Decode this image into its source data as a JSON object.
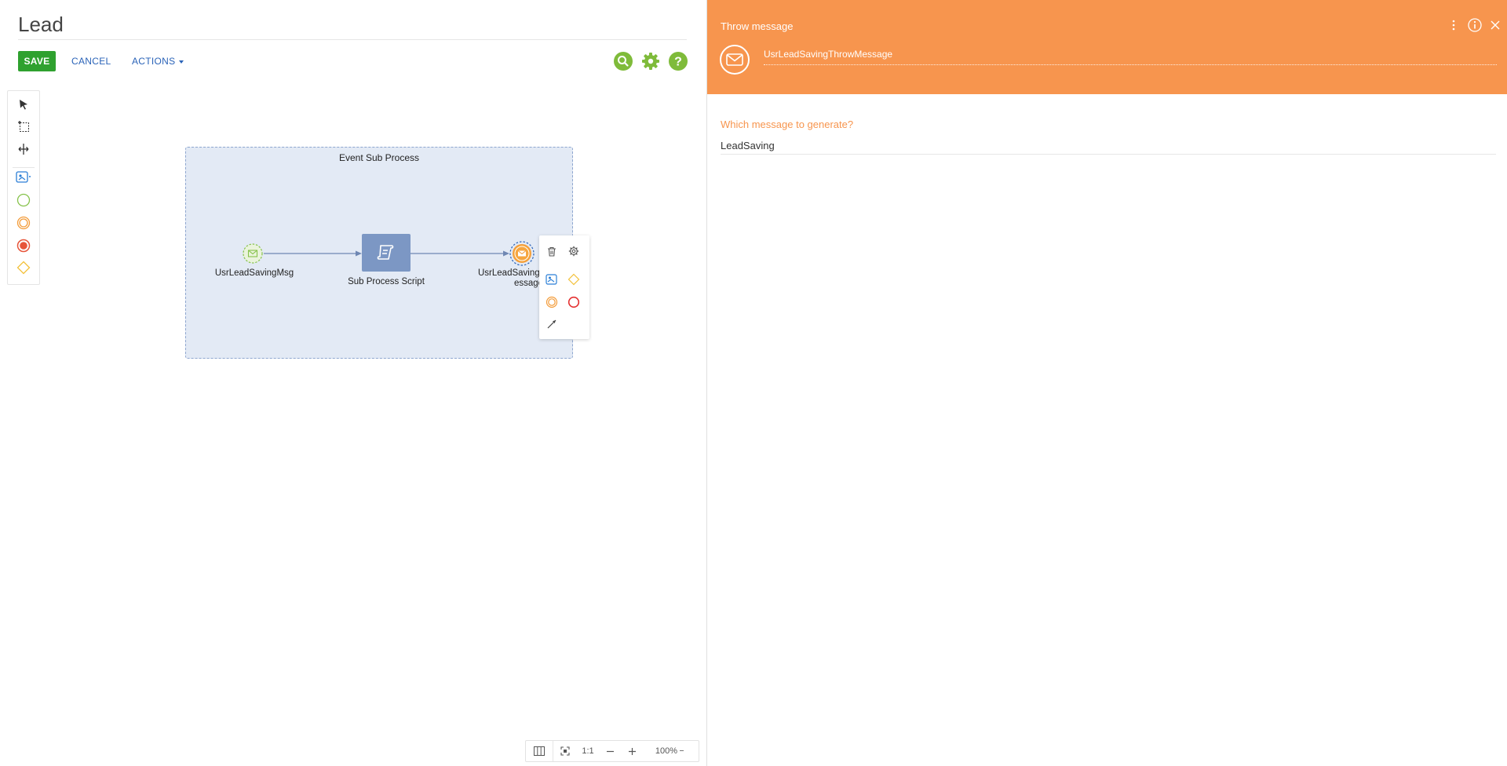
{
  "designer": {
    "title": "Lead",
    "toolbar": {
      "save_label": "SAVE",
      "cancel_label": "CANCEL",
      "actions_label": "ACTIONS"
    },
    "top_icons": [
      "search-icon",
      "gear-icon",
      "help-icon"
    ],
    "palette": [
      "pointer-tool",
      "lasso-tool",
      "space-tool",
      "script-task",
      "start-event",
      "intermediate-event",
      "end-event",
      "gateway"
    ],
    "subprocess": {
      "title": "Event Sub Process",
      "nodes": [
        {
          "label": "UsrLeadSavingMsg"
        },
        {
          "label": "Sub Process Script"
        },
        {
          "label_line1": "UsrLeadSavingT",
          "label_line2": "essage"
        }
      ]
    },
    "context_menu": [
      "trash-icon",
      "gear-icon",
      "script-task-icon",
      "gateway-icon",
      "intermediate-event-icon",
      "end-event-icon",
      "connector-icon"
    ],
    "zoom": {
      "fit_label": "1:1",
      "level": "100%"
    },
    "colors": {
      "save": "#2fa12f",
      "link": "#2a63b8",
      "subprocess_fill": "#e3eaf5",
      "script_task": "#7c97c4",
      "accent": "#f7954e"
    }
  },
  "panel": {
    "title": "Throw message",
    "element_name": "UsrLeadSavingThrowMessage",
    "question": "Which message to generate?",
    "message_value": "LeadSaving",
    "header_icons": [
      "more-icon",
      "info-icon",
      "close-icon"
    ],
    "colors": {
      "header": "#f7954e"
    }
  }
}
